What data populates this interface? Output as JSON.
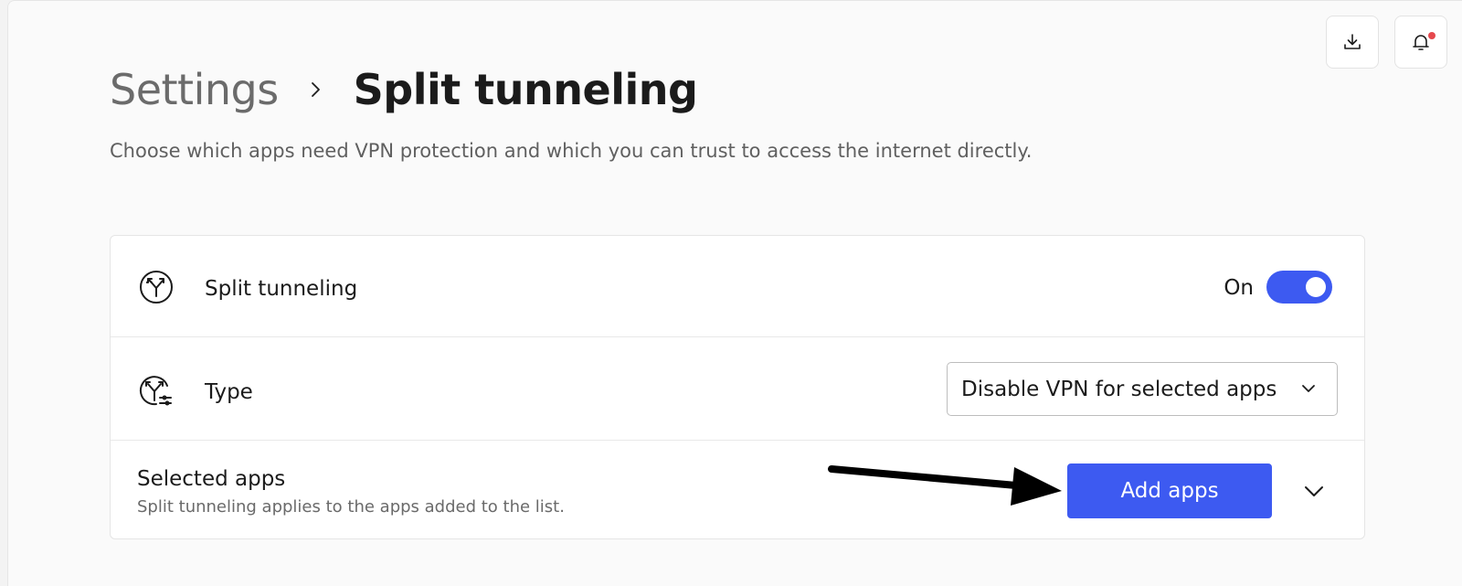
{
  "breadcrumb": {
    "parent": "Settings",
    "current": "Split tunneling"
  },
  "subtitle": "Choose which apps need VPN protection and which you can trust to access the internet directly.",
  "split_tunneling": {
    "label": "Split tunneling",
    "state_text": "On",
    "enabled": true,
    "icon": "split-arrow-icon"
  },
  "type": {
    "label": "Type",
    "selected": "Disable VPN for selected apps",
    "icon": "split-filter-icon"
  },
  "selected_apps": {
    "title": "Selected apps",
    "description": "Split tunneling applies to the apps added to the list.",
    "add_button": "Add apps"
  },
  "colors": {
    "accent": "#3d5af1",
    "notification_dot": "#e5484d"
  }
}
